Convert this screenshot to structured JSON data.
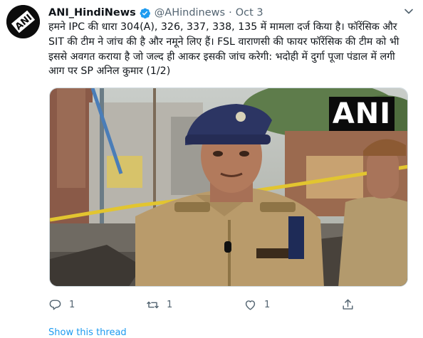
{
  "tweet": {
    "author_name": "ANI_HindiNews",
    "handle": "@AHindinews",
    "separator": "·",
    "date": "Oct 3",
    "text": "हमने IPC की धारा 304(A), 326, 337, 338, 135 में मामला दर्ज किया है। फॉरेंसिक और SIT की टीम ने जांच की है और नमूने लिए हैं। FSL वाराणसी की फायर फॉरेंसिक की टीम को भी इससे अवगत कराया है जो जल्द ही आकर इसकी जांच करेगी: भदोही में दुर्गा पूजा पंडाल में लगी आग पर SP अनिल कुमार (1/2)",
    "avatar_logo_text": "ANI",
    "media": {
      "badge_text": "ANI"
    },
    "actions": {
      "reply_count": "1",
      "retweet_count": "1",
      "like_count": "1"
    },
    "bottom_link": "Show this thread"
  },
  "colors": {
    "verified": "#1d9bf0",
    "icon_gray": "#536471",
    "link": "#1d9bf0"
  },
  "icons": [
    "verified-badge-icon",
    "more-caret-icon",
    "reply-icon",
    "retweet-icon",
    "like-icon",
    "share-icon"
  ]
}
